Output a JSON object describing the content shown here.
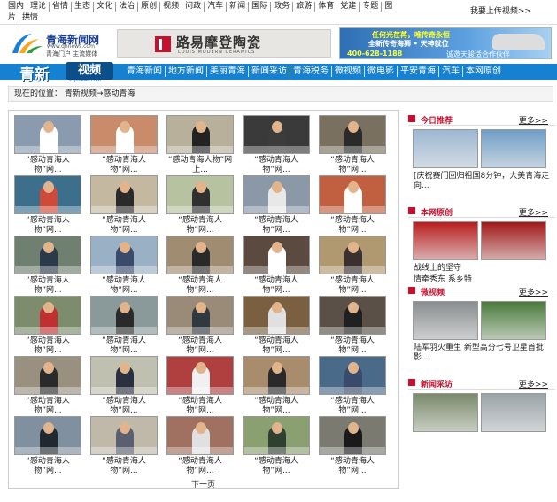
{
  "topnav": {
    "row1": [
      "国内",
      "理论",
      "省情",
      "生态",
      "文化",
      "法治",
      "原创",
      "视频",
      "问政",
      "汽车",
      "新闻",
      "国际",
      "政务",
      "旅游",
      "体育",
      "党建",
      "专题",
      "图"
    ],
    "row2": [
      "片",
      "拱情"
    ],
    "upload": "我要上传视频>>"
  },
  "logo": {
    "name": "青海新闻网",
    "url": "www.qhnews.com",
    "slogan": "青海门户  主流媒体"
  },
  "ads": {
    "louis_cn": "路易摩登陶瓷",
    "louis_en": "LOUIS MODERN CERAMICS",
    "car_line1": "任何光荏苒，唯传奇永恒",
    "car_line2": "全新传奇海狮 • 天神就位",
    "car_phone": "400-628-1188",
    "car_line3": "诚邀天骏适合作伙伴"
  },
  "channel": {
    "logo_cn": "青新",
    "logo_sp": "视频",
    "logo_url": "v.qhnews.com",
    "nav": [
      "青海新闻",
      "地方新闻",
      "美丽青海",
      "新闻采访",
      "青海税务",
      "微视频",
      "微电影",
      "平安青海",
      "汽车",
      "本网原创"
    ]
  },
  "breadcrumb": {
    "label": "现在的位置：",
    "path": "青新视频→感动青海"
  },
  "grid": {
    "captions": [
      [
        "“感动青海人",
        "物”网..."
      ],
      [
        "“感动青海人",
        "物”网..."
      ],
      [
        "“感动青海人物”网",
        "上..."
      ],
      [
        "“感动青海人",
        "物”网..."
      ],
      [
        "“感动青海人",
        "物”网..."
      ],
      [
        "“感动青海人",
        "物”网..."
      ],
      [
        "“感动青海人",
        "物”网..."
      ],
      [
        "“感动青海人",
        "物”网..."
      ],
      [
        "“感动青海人",
        "物”网..."
      ],
      [
        "“感动青海人",
        "物”网..."
      ],
      [
        "“感动青海人",
        "物”网..."
      ],
      [
        "“感动青海人",
        "物”网..."
      ],
      [
        "“感动青海人",
        "物”网..."
      ],
      [
        "“感动青海人",
        "物”网..."
      ],
      [
        "“感动青海人",
        "物”网..."
      ],
      [
        "“感动青海人",
        "物”网..."
      ],
      [
        "“感动青海人",
        "物”网..."
      ],
      [
        "“感动青海人",
        "物”网..."
      ],
      [
        "“感动青海人",
        "物”网..."
      ],
      [
        "“感动青海人",
        "物”网..."
      ],
      [
        "“感动青海人",
        "物”网..."
      ],
      [
        "“感动青海人",
        "物”网..."
      ],
      [
        "“感动青海人",
        "物”网..."
      ],
      [
        "“感动青海人",
        "物”网..."
      ],
      [
        "“感动青海人",
        "物”网..."
      ],
      [
        "“感动青海人",
        "物”网..."
      ],
      [
        "“感动青海人",
        "物”网..."
      ],
      [
        "“感动青海人",
        "物”网..."
      ],
      [
        "“感动青海人",
        "物”网..."
      ],
      [
        "“感动青海人",
        "物”网..."
      ]
    ],
    "thumb_colors": [
      [
        "#8a9bb0",
        "#ffffff"
      ],
      [
        "#c98b6a",
        "#ffffff"
      ],
      [
        "#b8b09a",
        "#222222"
      ],
      [
        "#3a3a3a",
        "#3c3c3c"
      ],
      [
        "#7a7060",
        "#2a2a2a"
      ],
      [
        "#3b6f8c",
        "#d04a3a"
      ],
      [
        "#c4b8a0",
        "#2a2a2a"
      ],
      [
        "#b6c2a0",
        "#303030"
      ],
      [
        "#8a98a8",
        "#e8e8e8"
      ],
      [
        "#c06040",
        "#ffffff"
      ],
      [
        "#6f7f70",
        "#2b3a4a"
      ],
      [
        "#9ab0c4",
        "#3a4a6a"
      ],
      [
        "#a08c70",
        "#2a2a2a"
      ],
      [
        "#5a4a40",
        "#ffffff"
      ],
      [
        "#b09870",
        "#3a3030"
      ],
      [
        "#7c8c6c",
        "#c03030"
      ],
      [
        "#8a9a9a",
        "#2a2a2a"
      ],
      [
        "#9a8a78",
        "#303840"
      ],
      [
        "#7a6040",
        "#e0e0e0"
      ],
      [
        "#5a5048",
        "#202020"
      ],
      [
        "#9a9080",
        "#2a2a2a"
      ],
      [
        "#c0c0b0",
        "#2a3040"
      ],
      [
        "#b04040",
        "#f0f0f0"
      ],
      [
        "#a88c6c",
        "#2a2a2a"
      ],
      [
        "#4a6a8a",
        "#3a4a6a"
      ],
      [
        "#8090a0",
        "#202830"
      ],
      [
        "#c0b8a8",
        "#5a6070"
      ],
      [
        "#a07060",
        "#e0e0e0"
      ],
      [
        "#8aa070",
        "#304030"
      ],
      [
        "#7a7a70",
        "#1a1a1a"
      ]
    ],
    "next": "下一页"
  },
  "sidebar": {
    "more": "更多>>",
    "sections": [
      {
        "title": "今日推荐",
        "captions": [
          "[庆祝赛门回归祖国8分钟，大美青海走向..."
        ],
        "pics": [
          "#9db8d4",
          "#6f9ec8"
        ]
      },
      {
        "title": "本网原创",
        "captions": [
          "战线上的坚守",
          "情牵秀东  系乡特"
        ],
        "pics": [
          "#b81e1e",
          "#a01818"
        ]
      },
      {
        "title": "微视频",
        "captions": [
          "陆军羽火重生  新型高分七号卫星首批影..."
        ],
        "pics": [
          "#8a8e90",
          "#4a7a3a"
        ]
      },
      {
        "title": "新闻采访",
        "captions": [],
        "pics": [
          "#7a8a6a",
          "#9aa4a8"
        ]
      }
    ]
  }
}
